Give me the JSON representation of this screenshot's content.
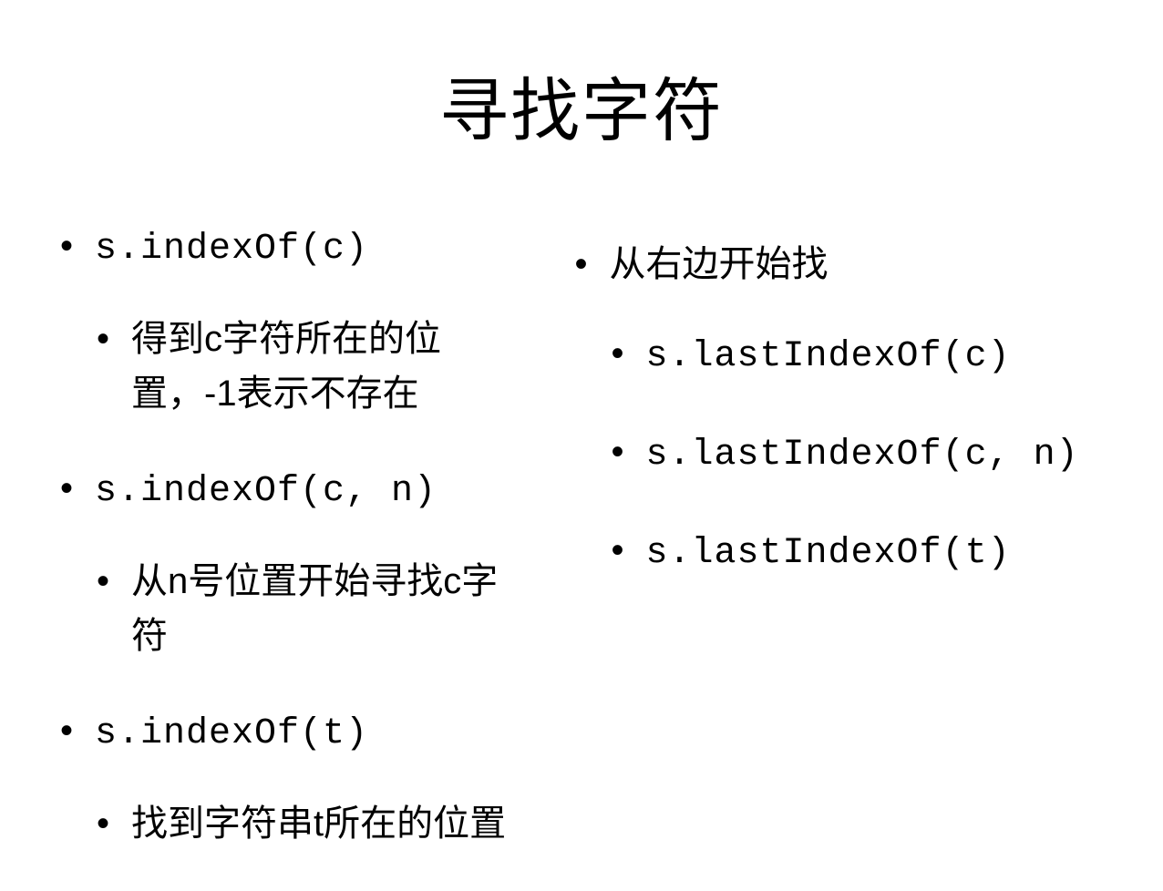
{
  "title": "寻找字符",
  "left": {
    "items": [
      {
        "level": "top",
        "text": "s.indexOf(c)",
        "code": true
      },
      {
        "level": "sub",
        "text": "得到c字符所在的位置，-1表示不存在",
        "code": false
      },
      {
        "level": "top",
        "text": "s.indexOf(c, n)",
        "code": true
      },
      {
        "level": "sub",
        "text": "从n号位置开始寻找c字符",
        "code": false
      },
      {
        "level": "top",
        "text": "s.indexOf(t)",
        "code": true
      },
      {
        "level": "sub",
        "text": "找到字符串t所在的位置",
        "code": false
      }
    ]
  },
  "right": {
    "items": [
      {
        "level": "top",
        "text": "从右边开始找",
        "code": false
      },
      {
        "level": "sub",
        "text": "s.lastIndexOf(c)",
        "code": true
      },
      {
        "level": "sub",
        "text": "s.lastIndexOf(c, n)",
        "code": true
      },
      {
        "level": "sub",
        "text": "s.lastIndexOf(t)",
        "code": true
      }
    ]
  }
}
